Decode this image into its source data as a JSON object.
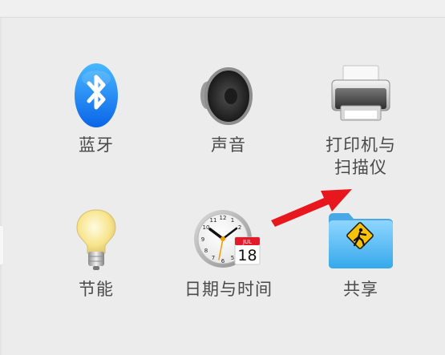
{
  "preferences": {
    "items": [
      {
        "label": "蓝牙",
        "icon": "bluetooth-icon"
      },
      {
        "label": "声音",
        "icon": "speaker-icon"
      },
      {
        "label": "打印机与\n扫描仪",
        "icon": "printer-icon"
      },
      {
        "label": "节能",
        "icon": "lightbulb-icon"
      },
      {
        "label": "日期与时间",
        "icon": "clock-calendar-icon"
      },
      {
        "label": "共享",
        "icon": "sharing-folder-icon"
      }
    ],
    "calendar_badge": {
      "month": "JUL",
      "day": "18"
    }
  },
  "annotation": {
    "arrow_color": "#e8171d"
  }
}
